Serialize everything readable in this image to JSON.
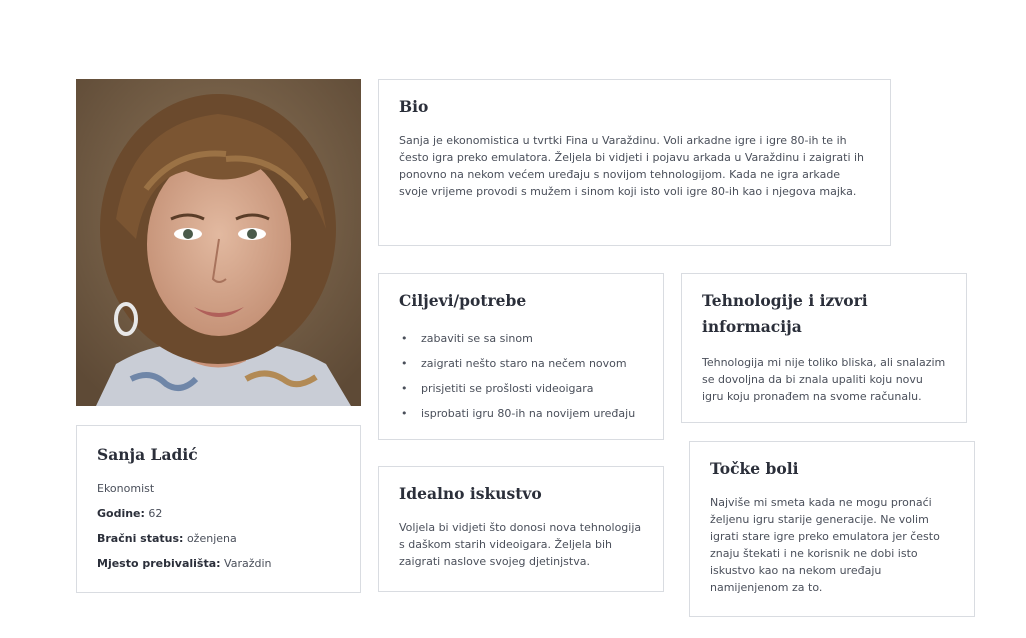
{
  "profile": {
    "name": "Sanja Ladić",
    "occupation": "Ekonomist",
    "age_label": "Godine:",
    "age_value": "62",
    "marital_label": "Bračni status:",
    "marital_value": "oženjena",
    "residence_label": "Mjesto prebivališta:",
    "residence_value": "Varaždin",
    "photo": "portrait-photo"
  },
  "bio": {
    "title": "Bio",
    "text": "Sanja je ekonomistica u tvrtki Fina u Varaždinu. Voli arkadne igre i igre 80-ih te ih često igra preko emulatora. Željela bi vidjeti i pojavu arkada u Varaždinu i zaigrati ih ponovno na nekom većem uređaju s novijom tehnologijom. Kada ne igra arkade svoje vrijeme provodi s mužem i sinom koji isto voli igre 80-ih kao i njegova majka."
  },
  "goals": {
    "title": "Ciljevi/potrebe",
    "items": [
      "zabaviti se sa sinom",
      "zaigrati nešto staro na nečem novom",
      "prisjetiti se prošlosti videoigara",
      "isprobati igru 80-ih na novijem uređaju"
    ]
  },
  "tech": {
    "title": "Tehnologije i izvori informacija",
    "text": "Tehnologija mi nije toliko bliska, ali snalazim se dovoljna da bi znala upaliti koju novu igru koju pronađem na svome računalu."
  },
  "ideal": {
    "title": "Idealno iskustvo",
    "text": "Voljela bi vidjeti što donosi nova tehnologija s daškom starih videoigara. Željela bih zaigrati naslove svojeg djetinjstva."
  },
  "pain": {
    "title": "Točke boli",
    "text": "Najviše mi smeta kada ne mogu pronaći željenu igru starije generacije. Ne volim igrati stare igre preko emulatora jer često znaju štekati i ne korisnik ne dobi isto iskustvo kao na nekom uređaju namijenjenom za to."
  }
}
